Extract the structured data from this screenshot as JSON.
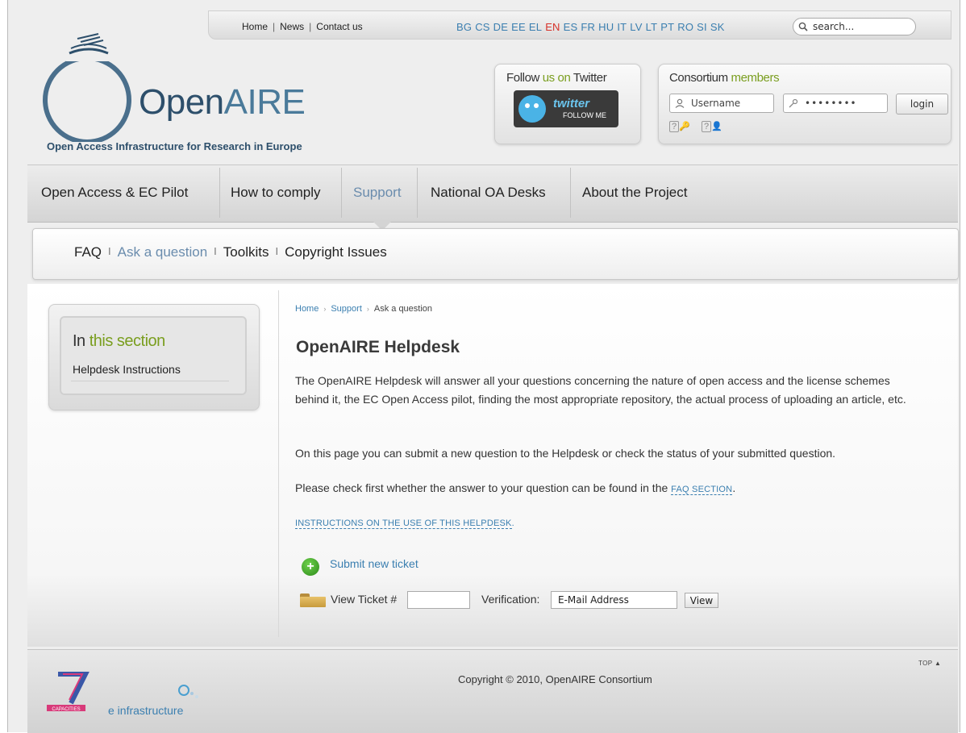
{
  "top": {
    "links": [
      "Home",
      "News",
      "Contact us"
    ],
    "languages": [
      "BG",
      "CS",
      "DE",
      "EE",
      "EL",
      "EN",
      "ES",
      "FR",
      "HU",
      "IT",
      "LV",
      "LT",
      "PT",
      "RO",
      "SI",
      "SK"
    ],
    "active_language": "EN",
    "search_placeholder": "search..."
  },
  "brand": {
    "logo_open": "Open",
    "logo_aire": "AIRE",
    "tagline": "Open Access Infrastructure for Research in Europe"
  },
  "twitter": {
    "title_a": "Follow ",
    "title_b": "us on",
    "title_c": " Twitter",
    "button_word": "twitter",
    "button_sub": "FOLLOW ME"
  },
  "login": {
    "title_a": "Consortium ",
    "title_b": "members",
    "username_placeholder": "Username",
    "password_value": "••••••••",
    "login_label": "login",
    "help_1": "?",
    "help_2": "?"
  },
  "nav": {
    "items": [
      "Open Access & EC Pilot",
      "How to comply",
      "Support",
      "National OA Desks",
      "About the Project"
    ],
    "active": "Support"
  },
  "subnav": {
    "items": [
      "FAQ",
      "Ask a question",
      "Toolkits",
      "Copyright Issues"
    ],
    "active": "Ask a question",
    "sep": "I"
  },
  "sidebar": {
    "title_a": "In ",
    "title_b": "this section",
    "link": "Helpdesk Instructions"
  },
  "breadcrumb": {
    "items": [
      "Home",
      "Support",
      "Ask a question"
    ],
    "sep": "›"
  },
  "content": {
    "title": "OpenAIRE Helpdesk",
    "para1": "The OpenAIRE Helpdesk will answer all your questions concerning the nature of open access and the license schemes behind it, the EC Open Access pilot, finding the most appropriate repository, the actual process of uploading an article, etc.",
    "para2": "On this page you can submit a new question to the Helpdesk or check the status of your submitted question.",
    "para3_prefix": "Please check first whether the answer to your question can be found in the ",
    "para3_link": "FAQ SECTION",
    "para3_suffix": ".",
    "instructions_link": "INSTRUCTIONS ON THE USE OF THIS HELPDESK",
    "instructions_suffix": ".",
    "submit_ticket": "Submit new ticket",
    "view_ticket_label": "View Ticket #",
    "verification_label": "Verification:",
    "email_placeholder": "E-Mail Address",
    "view_button": "View"
  },
  "footer": {
    "copyright": "Copyright © 2010, OpenAIRE Consortium",
    "top": "TOP ▲",
    "einfra": "e infrastructure",
    "fp7_label": "CAPACITIES"
  },
  "colors": {
    "accent_blue": "#3b7fb0",
    "accent_green": "#7a9e1f",
    "active_lang": "#d7322a",
    "nav_active": "#6a8cad"
  }
}
